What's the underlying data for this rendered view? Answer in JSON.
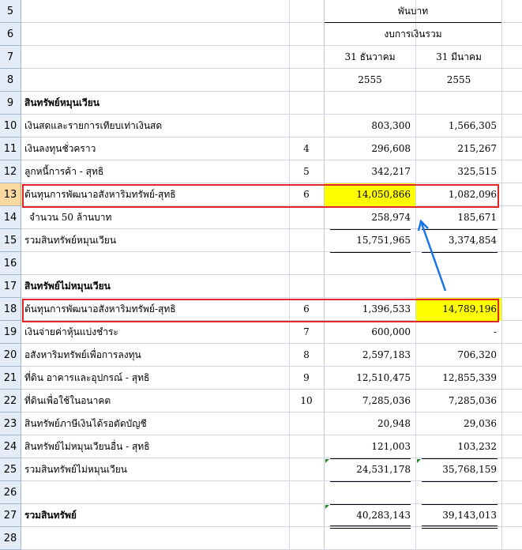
{
  "header": {
    "unit": "พันบาท",
    "statement": "งบการเงินรวม",
    "col1_date": "31 ธันวาคม",
    "col2_date": "31 มีนาคม",
    "col1_year": "2555",
    "col2_year": "2555"
  },
  "rows": [
    {
      "num": "5"
    },
    {
      "num": "6"
    },
    {
      "num": "7"
    },
    {
      "num": "8"
    },
    {
      "num": "9",
      "desc": "สินทรัพย์หมุนเวียน",
      "note": "",
      "v1": "",
      "v2": ""
    },
    {
      "num": "10",
      "desc": "เงินสดและรายการเทียบเท่าเงินสด",
      "note": "",
      "v1": "803,300",
      "v2": "1,566,305"
    },
    {
      "num": "11",
      "desc": "เงินลงทุนชั่วคราว",
      "note": "4",
      "v1": "296,608",
      "v2": "215,267"
    },
    {
      "num": "12",
      "desc": "ลูกหนี้การค้า - สุทธิ",
      "note": "5",
      "v1": "342,217",
      "v2": "325,515"
    },
    {
      "num": "13",
      "desc": "ต้นทุนการพัฒนาอสังหาริมทรัพย์-สุทธิ",
      "note": "6",
      "v1": "14,050,866",
      "v2": "1,082,096"
    },
    {
      "num": "14",
      "desc": "  จำนวน 50 ล้านบาท",
      "note": "",
      "v1": "258,974",
      "v2": "185,671"
    },
    {
      "num": "15",
      "desc": "รวมสินทรัพย์หมุนเวียน",
      "note": "",
      "v1": "15,751,965",
      "v2": "3,374,854"
    },
    {
      "num": "16",
      "desc": "",
      "note": "",
      "v1": "",
      "v2": ""
    },
    {
      "num": "17",
      "desc": "สินทรัพย์ไม่หมุนเวียน",
      "note": "",
      "v1": "",
      "v2": ""
    },
    {
      "num": "18",
      "desc": "ต้นทุนการพัฒนาอสังหาริมทรัพย์-สุทธิ",
      "note": "6",
      "v1": "1,396,533",
      "v2": "14,789,196"
    },
    {
      "num": "19",
      "desc": "เงินจ่ายค่าหุ้นแบ่งชำระ",
      "note": "7",
      "v1": "600,000",
      "v2": "-"
    },
    {
      "num": "20",
      "desc": "อสังหาริมทรัพย์เพื่อการลงทุน",
      "note": "8",
      "v1": "2,597,183",
      "v2": "706,320"
    },
    {
      "num": "21",
      "desc": "ที่ดิน อาคารและอุปกรณ์ - สุทธิ",
      "note": "9",
      "v1": "12,510,475",
      "v2": "12,855,339"
    },
    {
      "num": "22",
      "desc": "ที่ดินเพื่อใช้ในอนาคต",
      "note": "10",
      "v1": "7,285,036",
      "v2": "7,285,036"
    },
    {
      "num": "23",
      "desc": "สินทรัพย์ภาษีเงินได้รอตัดบัญชี",
      "note": "",
      "v1": "20,948",
      "v2": "29,036"
    },
    {
      "num": "24",
      "desc": "สินทรัพย์ไม่หมุนเวียนอื่น - สุทธิ",
      "note": "",
      "v1": "121,003",
      "v2": "103,232"
    },
    {
      "num": "25",
      "desc": "รวมสินทรัพย์ไม่หมุนเวียน",
      "note": "",
      "v1": "24,531,178",
      "v2": "35,768,159"
    },
    {
      "num": "26",
      "desc": "",
      "note": "",
      "v1": "",
      "v2": ""
    },
    {
      "num": "27",
      "desc": "รวมสินทรัพย์",
      "note": "",
      "v1": "40,283,143",
      "v2": "39,143,013"
    },
    {
      "num": "28",
      "desc": "",
      "note": "",
      "v1": "",
      "v2": ""
    }
  ],
  "colors": {
    "highlight": "#ffff00",
    "annotation_box": "#e0252b",
    "arrow": "#1a73e8",
    "row_header_bg": "#e4ecf7",
    "selected_row_header_bg": "#f9d99f"
  }
}
